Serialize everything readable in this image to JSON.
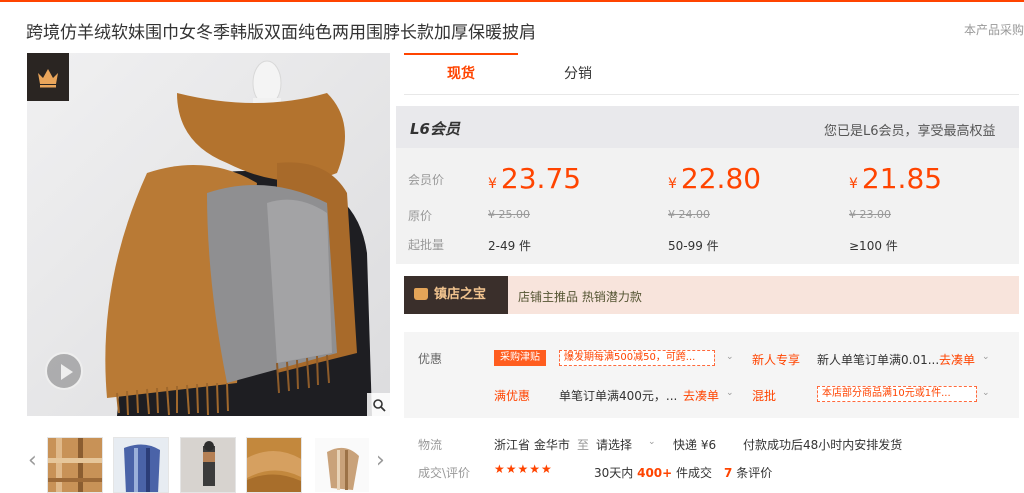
{
  "header": {
    "title": "跨境仿羊绒软妹围巾女冬季韩版双面纯色两用围脖长款加厚保暖披肩",
    "right_text": "本产品采购属"
  },
  "gallery": {
    "badge_icon": "crown-icon",
    "thumb_count": 5
  },
  "tabs": [
    {
      "label": "现货"
    },
    {
      "label": "分销"
    }
  ],
  "member": {
    "title": "L6会员",
    "status": "您已是L6会员，享受最高权益",
    "row_labels": {
      "member_price": "会员价",
      "original_price": "原价",
      "min_batch": "起批量"
    },
    "tiers": [
      {
        "currency": "¥",
        "price": "23.75",
        "original": "¥ 25.00",
        "quantity": "2-49 件"
      },
      {
        "currency": "¥",
        "price": "22.80",
        "original": "¥ 24.00",
        "quantity": "50-99 件"
      },
      {
        "currency": "¥",
        "price": "21.85",
        "original": "¥ 23.00",
        "quantity": "≥100 件"
      }
    ]
  },
  "shop": {
    "badge": "镇店之宝",
    "text": "店铺主推品   热销潜力款"
  },
  "promo": {
    "label": "优惠",
    "tag": "采购津贴",
    "coupon1": "爆发期每满500减50，可跨...",
    "new_user_label": "新人专享",
    "new_user_text": "新人单笔订单满0.01...",
    "go_link": "去凑单",
    "full_label": "满优惠",
    "full_text": "单笔订单满400元，...",
    "mix_label": "混批",
    "mix_coupon": "本店部分商品满10元或1件..."
  },
  "logistics": {
    "label": "物流",
    "origin": "浙江省 金华市",
    "to": "至",
    "select": "请选择",
    "express": "快递 ¥6",
    "shipping": "付款成功后48小时内安排发货"
  },
  "reviews": {
    "label": "成交\\评价",
    "stars": "★★★★★",
    "sales_prefix": "30天内",
    "sales_count": "400+",
    "sales_suffix": "件成交",
    "review_count": "7",
    "review_suffix": "条评价"
  },
  "colors": {
    "accent": "#ff4400",
    "badge_dark": "#2a2522"
  }
}
